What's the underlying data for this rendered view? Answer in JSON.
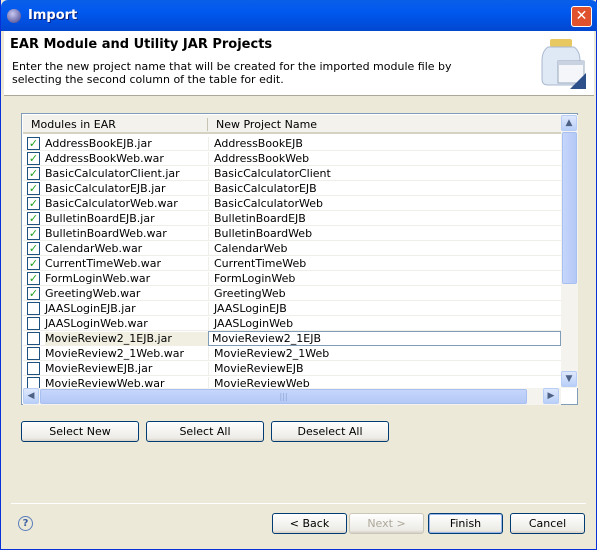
{
  "window": {
    "title": "Import",
    "close": "✕"
  },
  "banner": {
    "title": "EAR Module and Utility JAR Projects",
    "description": "Enter the new project name that will be created for the imported module file by selecting the second column of the table for edit."
  },
  "table": {
    "columns": [
      "Modules in EAR",
      "New Project Name"
    ],
    "rows": [
      {
        "module": "AddressBookEJB.jar",
        "project": "AddressBookEJB",
        "checked": true
      },
      {
        "module": "AddressBookWeb.war",
        "project": "AddressBookWeb",
        "checked": true
      },
      {
        "module": "BasicCalculatorClient.jar",
        "project": "BasicCalculatorClient",
        "checked": true
      },
      {
        "module": "BasicCalculatorEJB.jar",
        "project": "BasicCalculatorEJB",
        "checked": true
      },
      {
        "module": "BasicCalculatorWeb.war",
        "project": "BasicCalculatorWeb",
        "checked": true
      },
      {
        "module": "BulletinBoardEJB.jar",
        "project": "BulletinBoardEJB",
        "checked": true
      },
      {
        "module": "BulletinBoardWeb.war",
        "project": "BulletinBoardWeb",
        "checked": true
      },
      {
        "module": "CalendarWeb.war",
        "project": "CalendarWeb",
        "checked": true
      },
      {
        "module": "CurrentTimeWeb.war",
        "project": "CurrentTimeWeb",
        "checked": true
      },
      {
        "module": "FormLoginWeb.war",
        "project": "FormLoginWeb",
        "checked": true
      },
      {
        "module": "GreetingWeb.war",
        "project": "GreetingWeb",
        "checked": true
      },
      {
        "module": "JAASLoginEJB.jar",
        "project": "JAASLoginEJB",
        "checked": false
      },
      {
        "module": "JAASLoginWeb.war",
        "project": "JAASLoginWeb",
        "checked": false
      },
      {
        "module": "MovieReview2_1EJB.jar",
        "project": "MovieReview2_1EJB",
        "checked": false,
        "editing": true
      },
      {
        "module": "MovieReview2_1Web.war",
        "project": "MovieReview2_1Web",
        "checked": false
      },
      {
        "module": "MovieReviewEJB.jar",
        "project": "MovieReviewEJB",
        "checked": false
      },
      {
        "module": "MovieReviewWeb.war",
        "project": "MovieReviewWeb",
        "checked": false
      }
    ]
  },
  "selection_buttons": {
    "select_new": "Select New",
    "select_all": "Select All",
    "deselect_all": "Deselect All"
  },
  "footer": {
    "help": "?",
    "back": "< Back",
    "next": "Next >",
    "finish": "Finish",
    "cancel": "Cancel"
  }
}
